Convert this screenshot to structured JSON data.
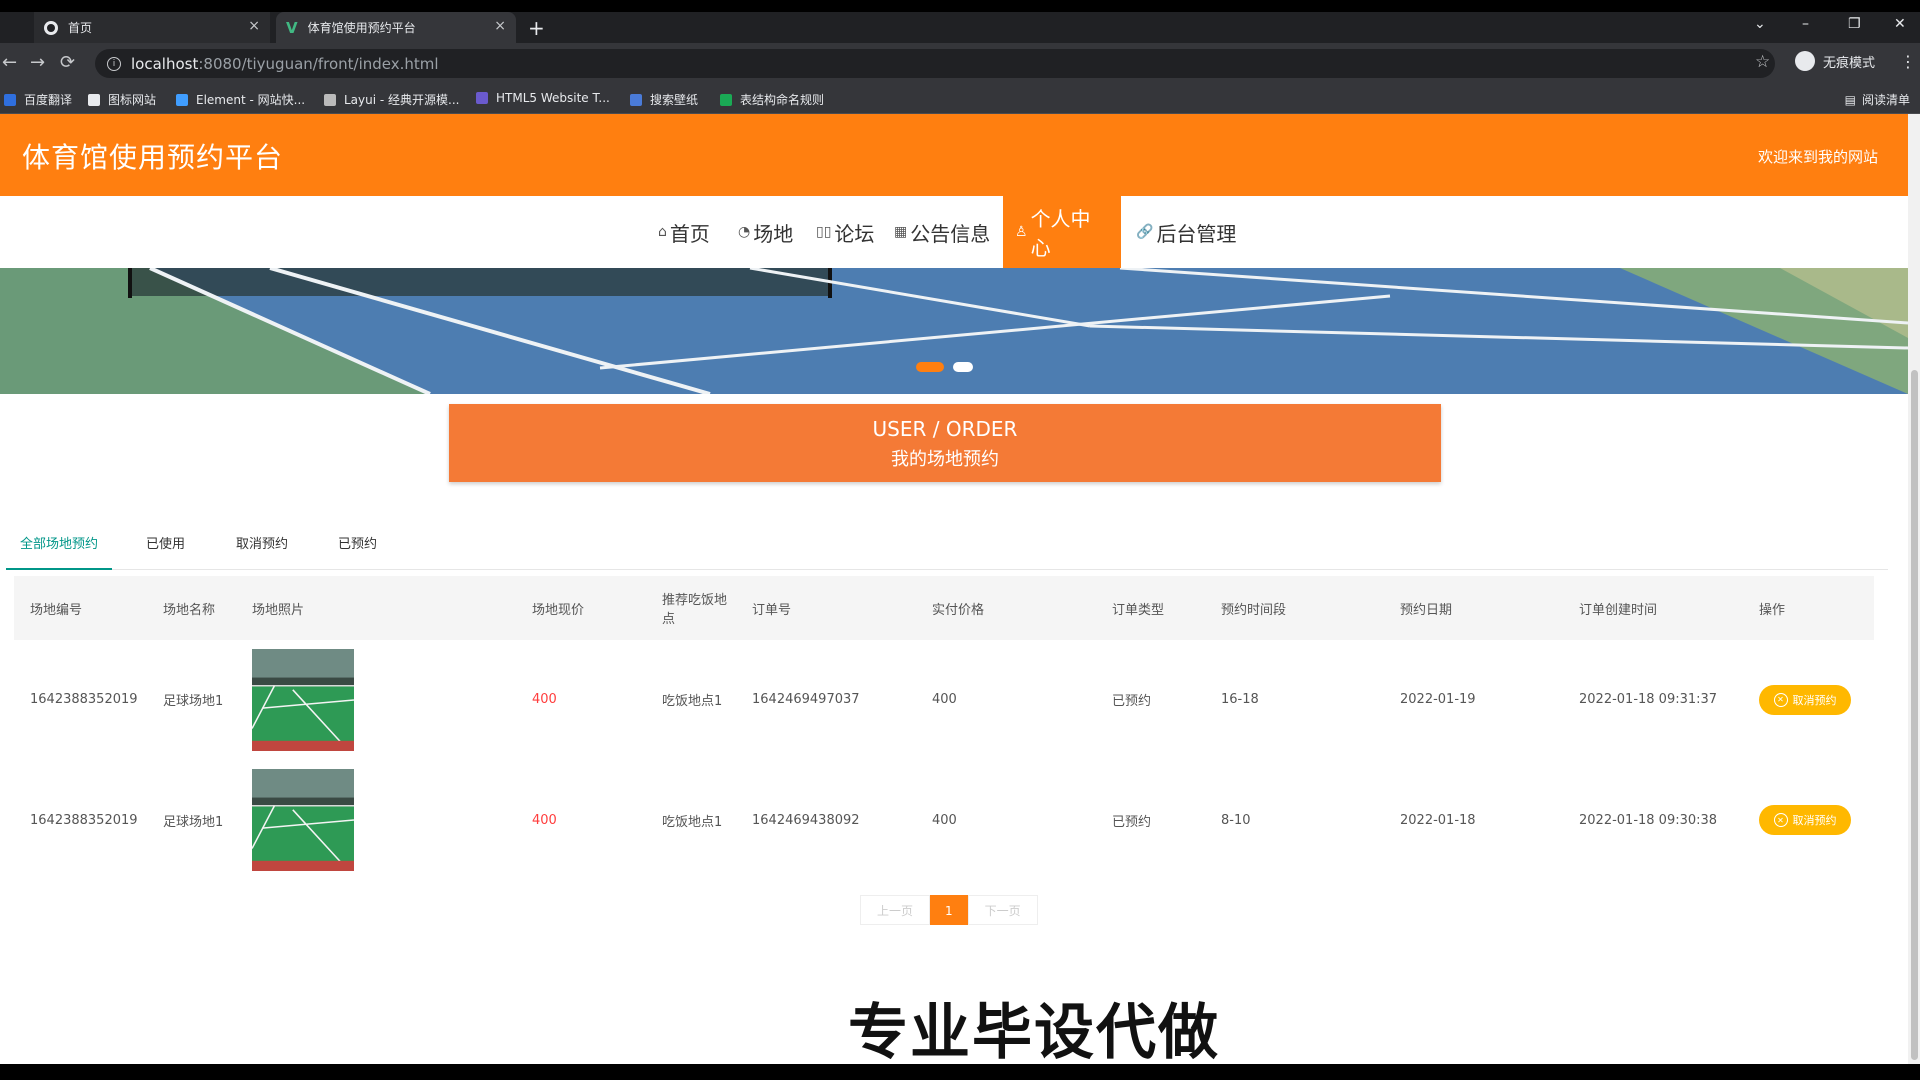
{
  "browser": {
    "tabs": [
      {
        "title": "首页",
        "close": "×"
      },
      {
        "title": "体育馆使用预约平台",
        "close": "×"
      }
    ],
    "new_tab": "+",
    "window_controls": {
      "dropdown": "⌄",
      "minimize": "–",
      "restore": "❐",
      "close": "✕"
    },
    "nav": {
      "back": "←",
      "forward": "→",
      "reload": "⟳"
    },
    "url_host": "localhost",
    "url_path": ":8080/tiyuguan/front/index.html",
    "star": "☆",
    "profile_label": "无痕模式",
    "menu": "⋮",
    "bookmarks": [
      {
        "label": "百度翻译",
        "color": "#2f6fde"
      },
      {
        "label": "图标网站",
        "color": "#e8eaed"
      },
      {
        "label": "Element - 网站快...",
        "color": "#409eff"
      },
      {
        "label": "Layui - 经典开源模...",
        "color": "#bbbbbb"
      },
      {
        "label": "HTML5 Website T...",
        "color": "#6a5acd"
      },
      {
        "label": "搜索壁纸",
        "color": "#4a7bd8"
      },
      {
        "label": "表结构命名规则",
        "color": "#1aaa55"
      }
    ],
    "reading_list": "阅读清单"
  },
  "site": {
    "title": "体育馆使用预约平台",
    "welcome": "欢迎来到我的网站",
    "nav": [
      {
        "label": "首页",
        "icon": "⌂"
      },
      {
        "label": "场地",
        "icon": "◔"
      },
      {
        "label": "论坛",
        "icon": "▯▯"
      },
      {
        "label": "公告信息",
        "icon": "▦"
      },
      {
        "label": "个人中心",
        "icon": "♙"
      },
      {
        "label": "后台管理",
        "icon": "🔗"
      }
    ],
    "active_nav": "个人中心"
  },
  "banner": {
    "slides": 2,
    "active_slide": 0
  },
  "section": {
    "title_en": "USER / ORDER",
    "title_zh": "我的场地预约"
  },
  "order_tabs": [
    "全部场地预约",
    "已使用",
    "取消预约",
    "已预约"
  ],
  "table": {
    "headers": [
      "场地编号",
      "场地名称",
      "场地照片",
      "场地现价",
      "推荐吃饭地点",
      "订单号",
      "实付价格",
      "订单类型",
      "预约时间段",
      "预约日期",
      "订单创建时间",
      "操作"
    ],
    "rows": [
      {
        "venue_id": "1642388352019",
        "venue_name": "足球场地1",
        "price": "400",
        "dining": "吃饭地点1",
        "order_no": "1642469497037",
        "paid": "400",
        "order_type": "已预约",
        "slot": "16-18",
        "date": "2022-01-19",
        "created": "2022-01-18 09:31:37",
        "action": "取消预约"
      },
      {
        "venue_id": "1642388352019",
        "venue_name": "足球场地1",
        "price": "400",
        "dining": "吃饭地点1",
        "order_no": "1642469438092",
        "paid": "400",
        "order_type": "已预约",
        "slot": "8-10",
        "date": "2022-01-18",
        "created": "2022-01-18 09:30:38",
        "action": "取消预约"
      }
    ]
  },
  "pager": {
    "prev": "上一页",
    "current": "1",
    "next": "下一页"
  },
  "watermark": "专业毕设代做",
  "colors": {
    "brand": "#ff7f10",
    "section": "#f47a36",
    "tab_active": "#009688",
    "price": "#ff3d3d",
    "cancel": "#ffb800"
  }
}
